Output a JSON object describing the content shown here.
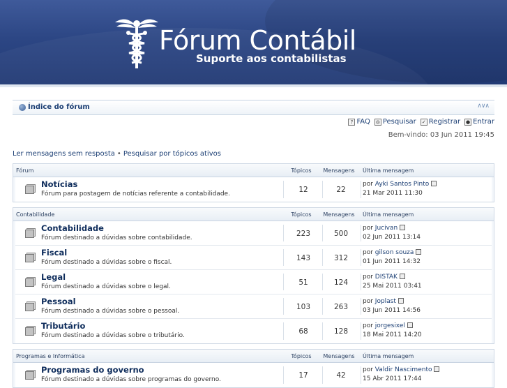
{
  "header": {
    "title": "Fórum Contábil",
    "subtitle": "Suporte aos contabilistas"
  },
  "navbar": {
    "breadcrumb": "Índice do fórum"
  },
  "userbar": {
    "faq": "FAQ",
    "search": "Pesquisar",
    "register": "Registrar",
    "login": "Entrar",
    "welcome": "Bem-vindo: 03 Jun 2011 19:45"
  },
  "quicklinks": {
    "unanswered": "Ler mensagens sem resposta",
    "sep": "•",
    "active": "Pesquisar por tópicos ativos"
  },
  "sections": [
    {
      "name": "Fórum",
      "col_topics": "Tópicos",
      "col_posts": "Mensagens",
      "col_last": "Última mensagem",
      "rows": [
        {
          "title": "Notícias",
          "desc": "Fórum para postagem de notícias referente a contabilidade.",
          "topics": "12",
          "posts": "22",
          "by": "por",
          "author": "Ayki Santos Pinto",
          "date": "21 Mar 2011 11:30"
        }
      ]
    },
    {
      "name": "Contabilidade",
      "col_topics": "Tópicos",
      "col_posts": "Mensagens",
      "col_last": "Última mensagem",
      "rows": [
        {
          "title": "Contabilidade",
          "desc": "Fórum destinado a dúvidas sobre contabilidade.",
          "topics": "223",
          "posts": "500",
          "by": "por",
          "author": "Jucivan",
          "date": "02 Jun 2011 13:14"
        },
        {
          "title": "Fiscal",
          "desc": "Fórum destinado a dúvidas sobre o fiscal.",
          "topics": "143",
          "posts": "312",
          "by": "por",
          "author": "gilson souza",
          "date": "01 Jun 2011 14:32"
        },
        {
          "title": "Legal",
          "desc": "Fórum destinado a dúvidas sobre o legal.",
          "topics": "51",
          "posts": "124",
          "by": "por",
          "author": "DISTAK",
          "date": "25 Mai 2011 03:41"
        },
        {
          "title": "Pessoal",
          "desc": "Fórum destinado a dúvidas sobre o pessoal.",
          "topics": "103",
          "posts": "263",
          "by": "por",
          "author": "Joplast",
          "date": "03 Jun 2011 14:56"
        },
        {
          "title": "Tributário",
          "desc": "Fórum destinado a dúvidas sobre o tributário.",
          "topics": "68",
          "posts": "128",
          "by": "por",
          "author": "jorgesixel",
          "date": "18 Mai 2011 14:20"
        }
      ]
    },
    {
      "name": "Programas e Informática",
      "col_topics": "Tópicos",
      "col_posts": "Mensagens",
      "col_last": "Última mensagem",
      "rows": [
        {
          "title": "Programas do governo",
          "desc": "Fórum destinado a dúvidas sobre programas do governo.",
          "topics": "17",
          "posts": "42",
          "by": "por",
          "author": "Valdir Nascimento",
          "date": "15 Abr 2011 17:44"
        }
      ]
    }
  ]
}
